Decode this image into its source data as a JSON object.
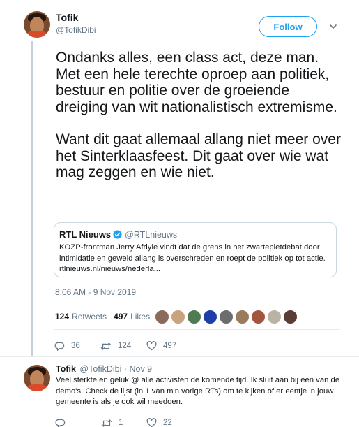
{
  "main_tweet": {
    "author_name": "Tofik",
    "author_handle": "@TofikDibi",
    "follow_label": "Follow",
    "paragraphs": [
      "Ondanks alles, een class act, deze man. Met een hele terechte oproep aan politiek, bestuur en politie over de groeiende dreiging van wit nationalistisch extremisme.",
      "Want dit gaat allemaal allang niet meer over het Sinterklaasfeest. Dit gaat over wie wat mag zeggen en wie niet."
    ],
    "quote": {
      "name": "RTL Nieuws",
      "handle": "@RTLnieuws",
      "text": "KOZP-frontman Jerry Afriyie vindt dat de grens in het zwartepietdebat door intimidatie en geweld allang is overschreden en roept de politiek op tot actie. rtlnieuws.nl/nieuws/nederla..."
    },
    "timestamp": "8:06 AM - 9 Nov 2019",
    "retweets_count": "124",
    "retweets_label": "Retweets",
    "likes_count": "497",
    "likes_label": "Likes",
    "likers": [
      {
        "name": "liker-1",
        "color": "#8a6a5a"
      },
      {
        "name": "liker-2",
        "color": "#c9a27e"
      },
      {
        "name": "liker-3",
        "color": "#4f7a52"
      },
      {
        "name": "liker-4",
        "color": "#1f3fa8"
      },
      {
        "name": "liker-5",
        "color": "#6d6d6d"
      },
      {
        "name": "liker-6",
        "color": "#9b7b5e"
      },
      {
        "name": "liker-7",
        "color": "#a3563e"
      },
      {
        "name": "liker-8",
        "color": "#b9b3a6"
      },
      {
        "name": "liker-9",
        "color": "#5a3d33"
      }
    ],
    "actions": {
      "replies": "36",
      "retweets": "124",
      "likes": "497"
    }
  },
  "reply_tweet": {
    "author_name": "Tofik",
    "author_handle": "@TofikDibi",
    "separator": " · ",
    "date": "Nov 9",
    "text": "Veel sterkte en geluk @ alle activisten de komende tijd. Ik sluit aan bij een van de demo's. Check de lijst (in 1 van m'n vorige RTs) om te kijken of er eentje in jouw gemeente is als je ook wil meedoen.",
    "actions": {
      "replies": "",
      "retweets": "1",
      "likes": "22"
    }
  },
  "colors": {
    "accent": "#1da1f2",
    "verified": "#1da1f2",
    "muted": "#657786",
    "text": "#14171a"
  }
}
